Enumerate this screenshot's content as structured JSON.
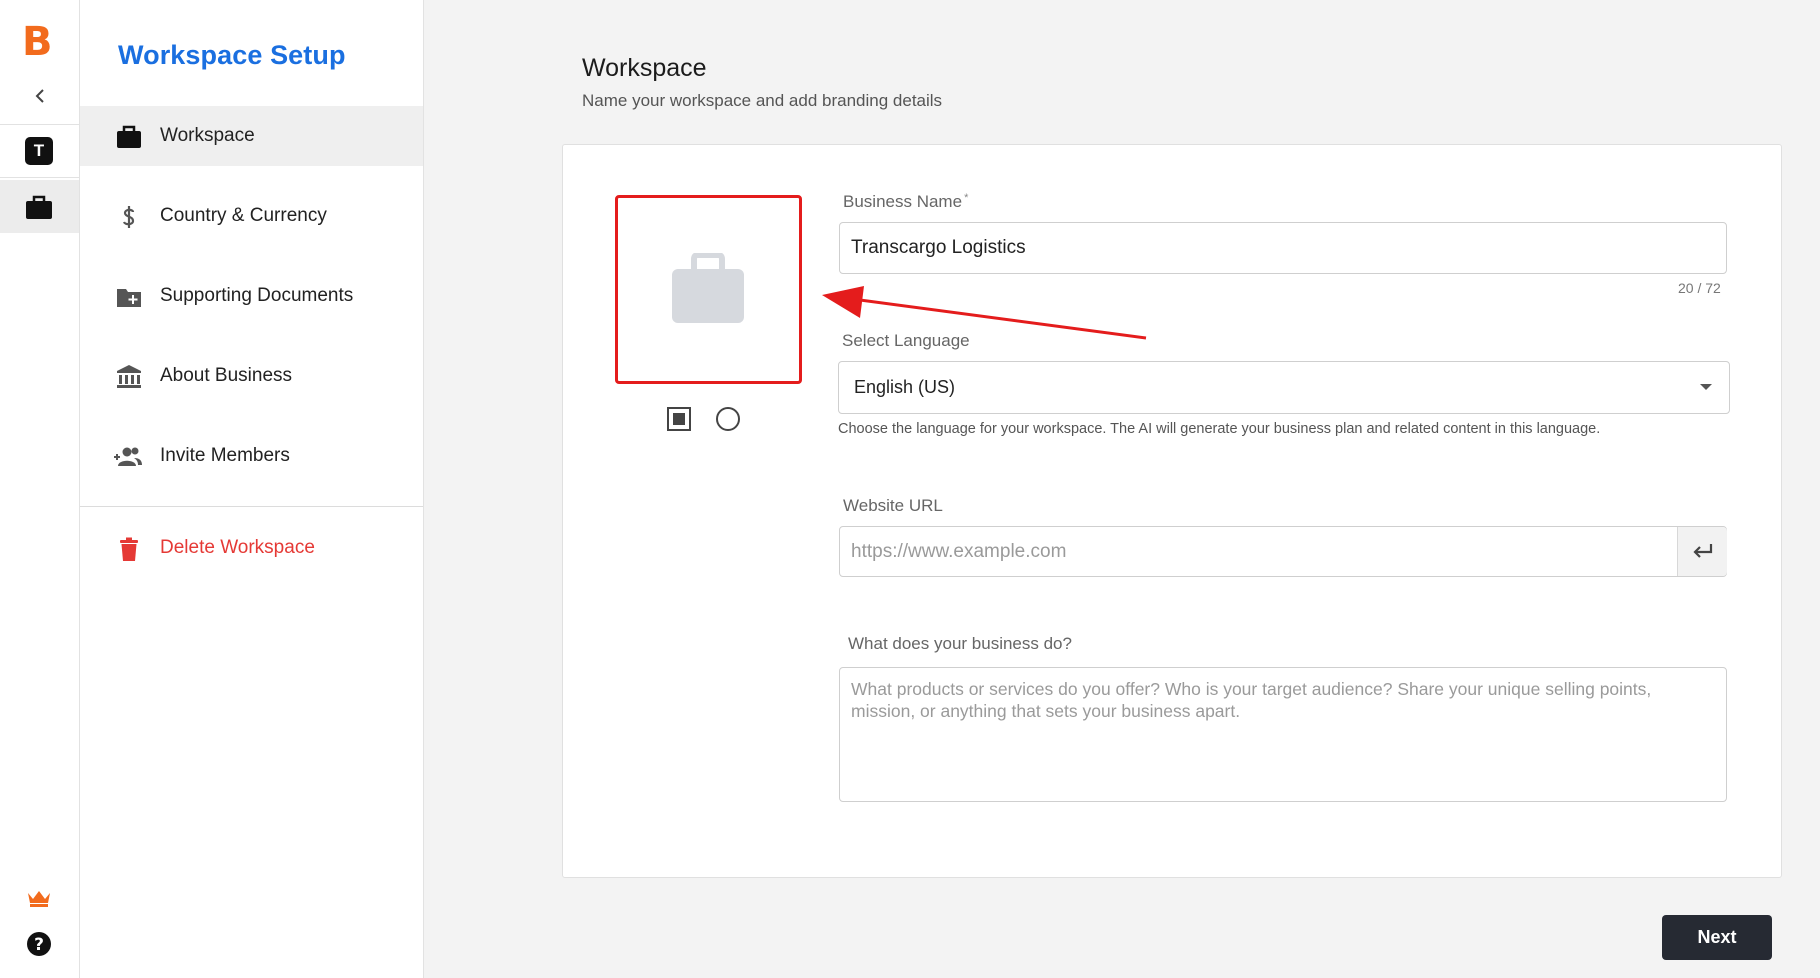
{
  "rail": {
    "brand_letter": "B",
    "workspace_initial": "T",
    "accent": "#f26b1d"
  },
  "sidebar": {
    "title": "Workspace Setup",
    "items": [
      {
        "label": "Workspace",
        "icon": "briefcase-icon",
        "active": true
      },
      {
        "label": "Country & Currency",
        "icon": "dollar-icon"
      },
      {
        "label": "Supporting Documents",
        "icon": "folder-plus-icon"
      },
      {
        "label": "About Business",
        "icon": "bank-icon"
      },
      {
        "label": "Invite Members",
        "icon": "add-group-icon"
      }
    ],
    "delete_label": "Delete Workspace"
  },
  "main": {
    "title": "Workspace",
    "subtitle": "Name your workspace and add branding details"
  },
  "form": {
    "business_name": {
      "label": "Business Name",
      "required_mark": "*",
      "value": "Transcargo Logistics",
      "counter": "20 / 72"
    },
    "language": {
      "label": "Select Language",
      "value": "English (US)",
      "help": "Choose the language for your workspace. The AI will generate your business plan and related content in this language."
    },
    "website": {
      "label": "Website URL",
      "placeholder": "https://www.example.com"
    },
    "description": {
      "label": "What does your business do?",
      "placeholder": "What products or services do you offer? Who is your target audience? Share your unique selling points, mission, or anything that sets your business apart."
    },
    "logo_shape_selected": "square"
  },
  "footer": {
    "next_label": "Next"
  },
  "colors": {
    "title_blue": "#1a6fe0",
    "danger": "#e53935",
    "annotation": "#e41c1c",
    "button_dark": "#262a33"
  }
}
